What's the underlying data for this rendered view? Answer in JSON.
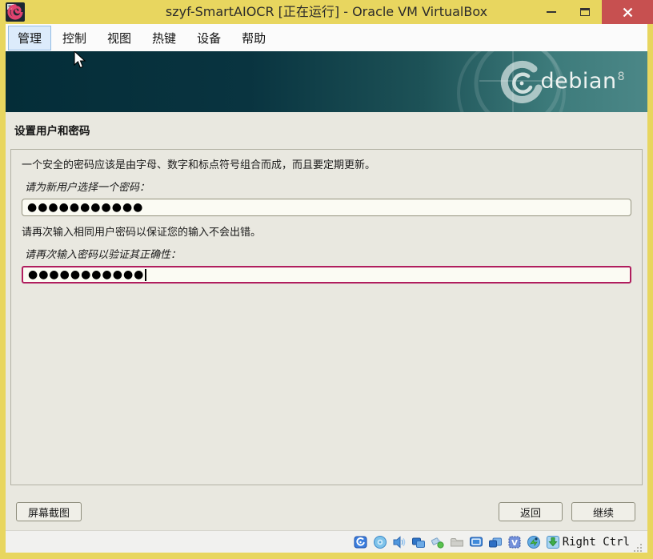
{
  "window": {
    "title": "szyf-SmartAIOCR [正在运行] - Oracle VM VirtualBox",
    "controls": {
      "minimize": "minimize",
      "maximize": "maximize",
      "close": "close"
    },
    "frame_color": "#e8d65f",
    "close_color": "#c75050"
  },
  "menu": {
    "items": [
      {
        "label": "管理",
        "active": true
      },
      {
        "label": "控制",
        "active": false
      },
      {
        "label": "视图",
        "active": false
      },
      {
        "label": "热键",
        "active": false
      },
      {
        "label": "设备",
        "active": false
      },
      {
        "label": "帮助",
        "active": false
      }
    ]
  },
  "banner": {
    "brand": "debian",
    "version": "8",
    "color_left": "#042d38",
    "color_right": "#4b8787"
  },
  "installer": {
    "heading": "设置用户和密码",
    "intro1": "一个安全的密码应该是由字母、数字和标点符号组合而成，而且要定期更新。",
    "label1": "请为新用户选择一个密码：",
    "password1": "●●●●●●●●●●●",
    "intro2": "请再次输入相同用户密码以保证您的输入不会出错。",
    "label2": "请再次输入密码以验证其正确性：",
    "password2": "●●●●●●●●●●●",
    "focus_border_color": "#b01d5e",
    "buttons": {
      "screenshot": "屏幕截图",
      "back": "返回",
      "continue": "继续"
    }
  },
  "statusbar": {
    "hostkey": "Right Ctrl",
    "icons": [
      "hard-disk",
      "optical-drive",
      "audio",
      "network",
      "usb",
      "shared-folder",
      "display",
      "recording",
      "features",
      "mouse-integration",
      "keyboard-capture"
    ]
  }
}
